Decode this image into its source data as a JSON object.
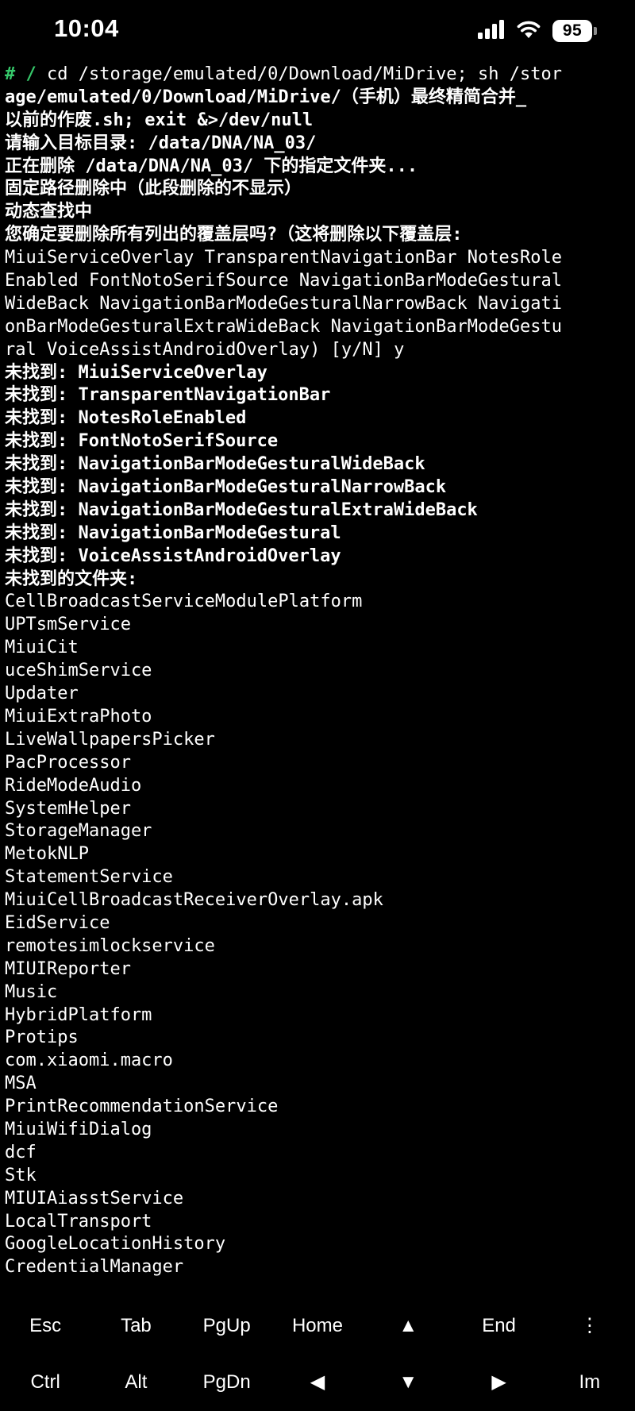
{
  "status_bar": {
    "time": "10:04",
    "battery": "95"
  },
  "terminal": {
    "prompt": "# /",
    "lines": [
      " cd /storage/emulated/0/Download/MiDrive; sh /stor",
      "age/emulated/0/Download/MiDrive/（手机）最终精简合并_",
      "以前的作废.sh; exit &>/dev/null",
      "请输入目标目录: /data/DNA/NA_03/",
      "正在删除 /data/DNA/NA_03/ 下的指定文件夹...",
      "固定路径删除中（此段删除的不显示）",
      "动态查找中",
      "您确定要删除所有列出的覆盖层吗?（这将删除以下覆盖层:",
      "MiuiServiceOverlay TransparentNavigationBar NotesRole",
      "Enabled FontNotoSerifSource NavigationBarModeGestural",
      "WideBack NavigationBarModeGesturalNarrowBack Navigati",
      "onBarModeGesturalExtraWideBack NavigationBarModeGestu",
      "ral VoiceAssistAndroidOverlay) [y/N] y",
      "未找到: MiuiServiceOverlay",
      "未找到: TransparentNavigationBar",
      "未找到: NotesRoleEnabled",
      "未找到: FontNotoSerifSource",
      "未找到: NavigationBarModeGesturalWideBack",
      "未找到: NavigationBarModeGesturalNarrowBack",
      "未找到: NavigationBarModeGesturalExtraWideBack",
      "未找到: NavigationBarModeGestural",
      "未找到: VoiceAssistAndroidOverlay",
      "未找到的文件夹:",
      "CellBroadcastServiceModulePlatform",
      "UPTsmService",
      "MiuiCit",
      "uceShimService",
      "Updater",
      "MiuiExtraPhoto",
      "LiveWallpapersPicker",
      "PacProcessor",
      "RideModeAudio",
      "SystemHelper",
      "StorageManager",
      "MetokNLP",
      "StatementService",
      "MiuiCellBroadcastReceiverOverlay.apk",
      "EidService",
      "remotesimlockservice",
      "MIUIReporter",
      "Music",
      "HybridPlatform",
      "Protips",
      "com.xiaomi.macro",
      "MSA",
      "PrintRecommendationService",
      "MiuiWifiDialog",
      "dcf",
      "Stk",
      "MIUIAiasstService",
      "LocalTransport",
      "GoogleLocationHistory",
      "CredentialManager"
    ]
  },
  "extra_keys": {
    "row1": [
      "Esc",
      "Tab",
      "PgUp",
      "Home",
      "▲",
      "End",
      "⋮"
    ],
    "row2": [
      "Ctrl",
      "Alt",
      "PgDn",
      "◀",
      "▼",
      "▶",
      "Im"
    ]
  }
}
